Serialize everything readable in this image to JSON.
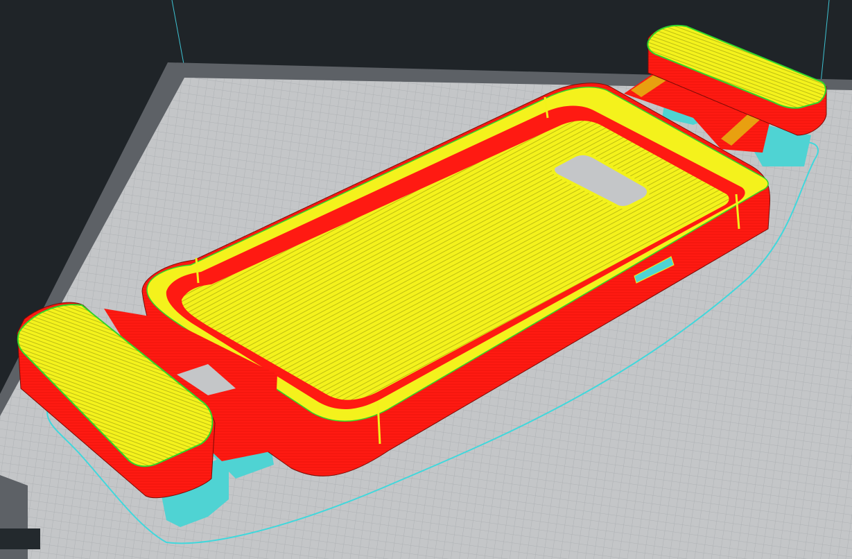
{
  "app": {
    "view": "layer-preview"
  },
  "colors": {
    "background": "#1f2428",
    "build_plate_edge": "#5d6166",
    "build_plate_surface": "#c4c6c8",
    "grid_line": "#aeb1b4",
    "outer_wall": "#ff1a12",
    "top_bottom_skin": "#f2f21a",
    "inner_wall": "#2fd62a",
    "support": "#4fd3d3",
    "skirt": "#40d8dc",
    "volume_edge": "#3ec2d2"
  },
  "legend_icons": [
    "build-plate-icon",
    "phone-case-model-icon",
    "support-structure-icon",
    "skirt-outline-icon"
  ]
}
